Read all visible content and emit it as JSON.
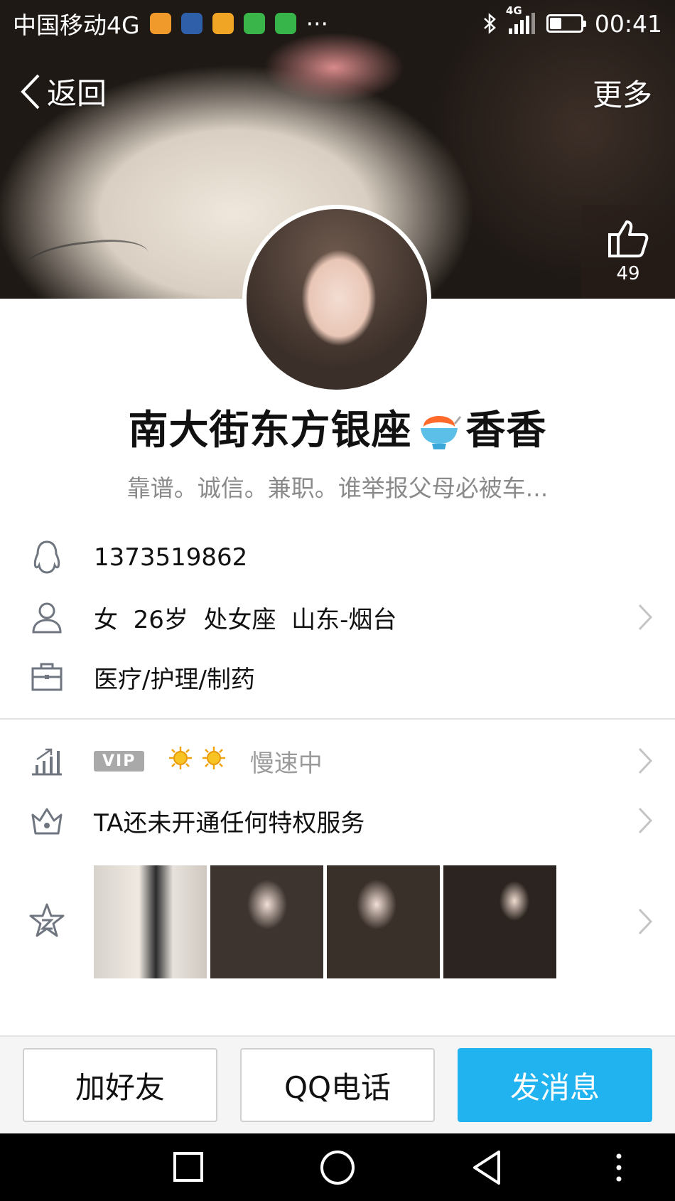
{
  "status_bar": {
    "carrier": "中国移动4G",
    "more_dots": "···",
    "network": "4G",
    "time": "00:41",
    "app_icon_colors": [
      "#f09a2c",
      "#2f5fa8",
      "#f0a524",
      "#39b54a",
      "#38b54a"
    ]
  },
  "nav": {
    "back_label": "返回",
    "more_label": "更多"
  },
  "like": {
    "count": "49"
  },
  "profile": {
    "name_prefix": "南大街东方银座",
    "name_suffix": "香香",
    "signature": "靠谱。诚信。兼职。谁举报父母必被车..."
  },
  "info": {
    "qq_number": "1373519862",
    "gender": "女",
    "age": "26岁",
    "zodiac": "处女座",
    "location": "山东-烟台",
    "occupation": "医疗/护理/制药"
  },
  "level": {
    "vip_badge": "VIP",
    "status": "慢速中"
  },
  "privilege": {
    "text": "TA还未开通任何特权服务"
  },
  "actions": {
    "add_friend": "加好友",
    "qq_call": "QQ电话",
    "send_message": "发消息"
  },
  "colors": {
    "primary": "#20b3ef",
    "icon_gray": "#6f7680"
  }
}
